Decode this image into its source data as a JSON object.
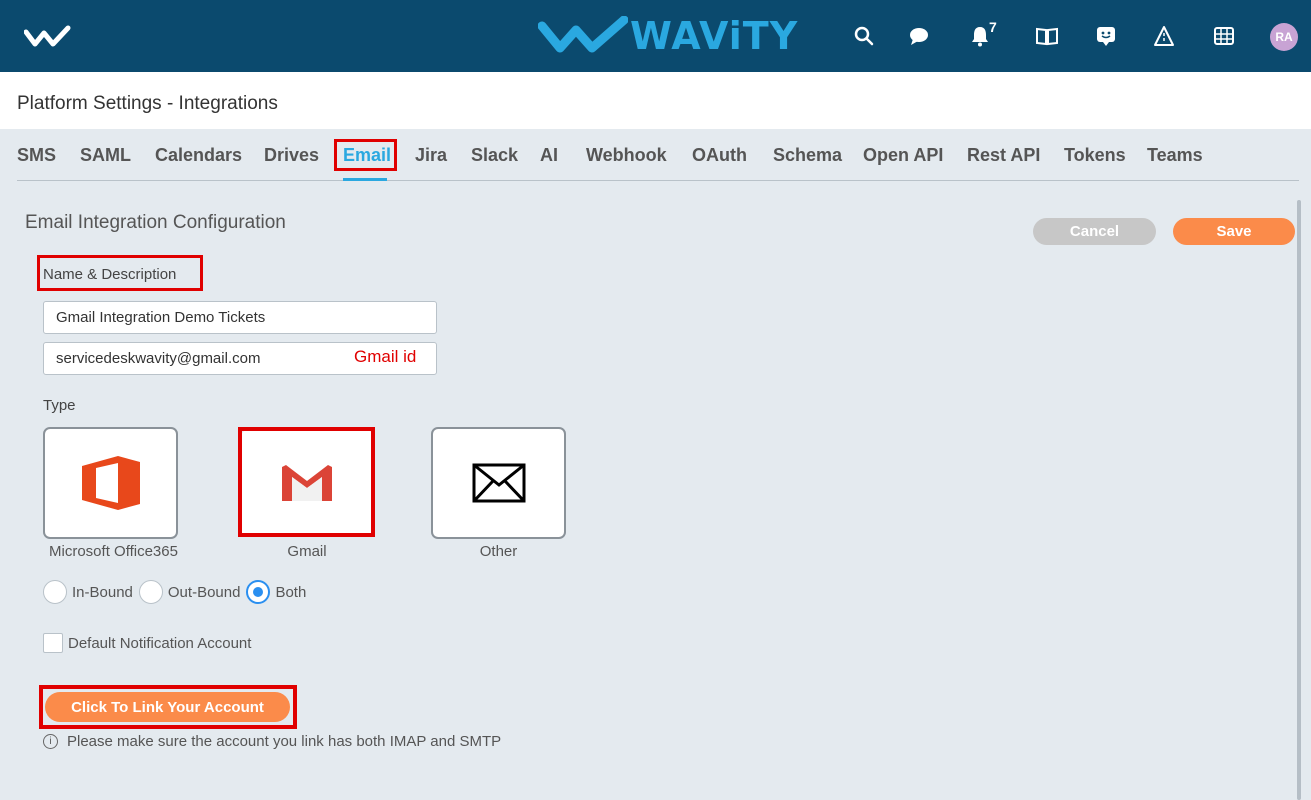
{
  "header": {
    "brand": "WAViTY",
    "notification_count": "7",
    "avatar_initials": "RA",
    "icons": [
      "menu-logo-icon",
      "search-icon",
      "chat-icon",
      "bell-icon",
      "book-icon",
      "feedback-icon",
      "road-icon",
      "grid-icon"
    ]
  },
  "page": {
    "title": "Platform Settings - Integrations"
  },
  "tabs": [
    {
      "label": "SMS"
    },
    {
      "label": "SAML"
    },
    {
      "label": "Calendars"
    },
    {
      "label": "Drives"
    },
    {
      "label": "Email",
      "active": true
    },
    {
      "label": "Jira"
    },
    {
      "label": "Slack"
    },
    {
      "label": "AI"
    },
    {
      "label": "Webhook"
    },
    {
      "label": "OAuth"
    },
    {
      "label": "Schema"
    },
    {
      "label": "Open API"
    },
    {
      "label": "Rest API"
    },
    {
      "label": "Tokens"
    },
    {
      "label": "Teams"
    }
  ],
  "form": {
    "section_title": "Email Integration Configuration",
    "cancel_label": "Cancel",
    "save_label": "Save",
    "name_desc_label": "Name & Description",
    "name_value": "Gmail Integration Demo Tickets",
    "description_value": "servicedeskwavity@gmail.com",
    "gmail_note": "Gmail id",
    "type_label": "Type",
    "types": [
      {
        "label": "Microsoft Office365",
        "icon": "office365-icon"
      },
      {
        "label": "Gmail",
        "icon": "gmail-icon",
        "selected": true
      },
      {
        "label": "Other",
        "icon": "envelope-icon"
      }
    ],
    "directions": [
      {
        "label": "In-Bound",
        "checked": false
      },
      {
        "label": "Out-Bound",
        "checked": false
      },
      {
        "label": "Both",
        "checked": true
      }
    ],
    "default_notification_label": "Default Notification Account",
    "default_notification_checked": false,
    "link_button_label": "Click To Link Your Account",
    "info_text": "Please make sure the account you link has both IMAP and SMTP"
  },
  "colors": {
    "header_bg": "#0b4a6e",
    "accent_blue": "#2aa8e0",
    "accent_orange": "#fb8b4a",
    "highlight_red": "#e00000"
  }
}
